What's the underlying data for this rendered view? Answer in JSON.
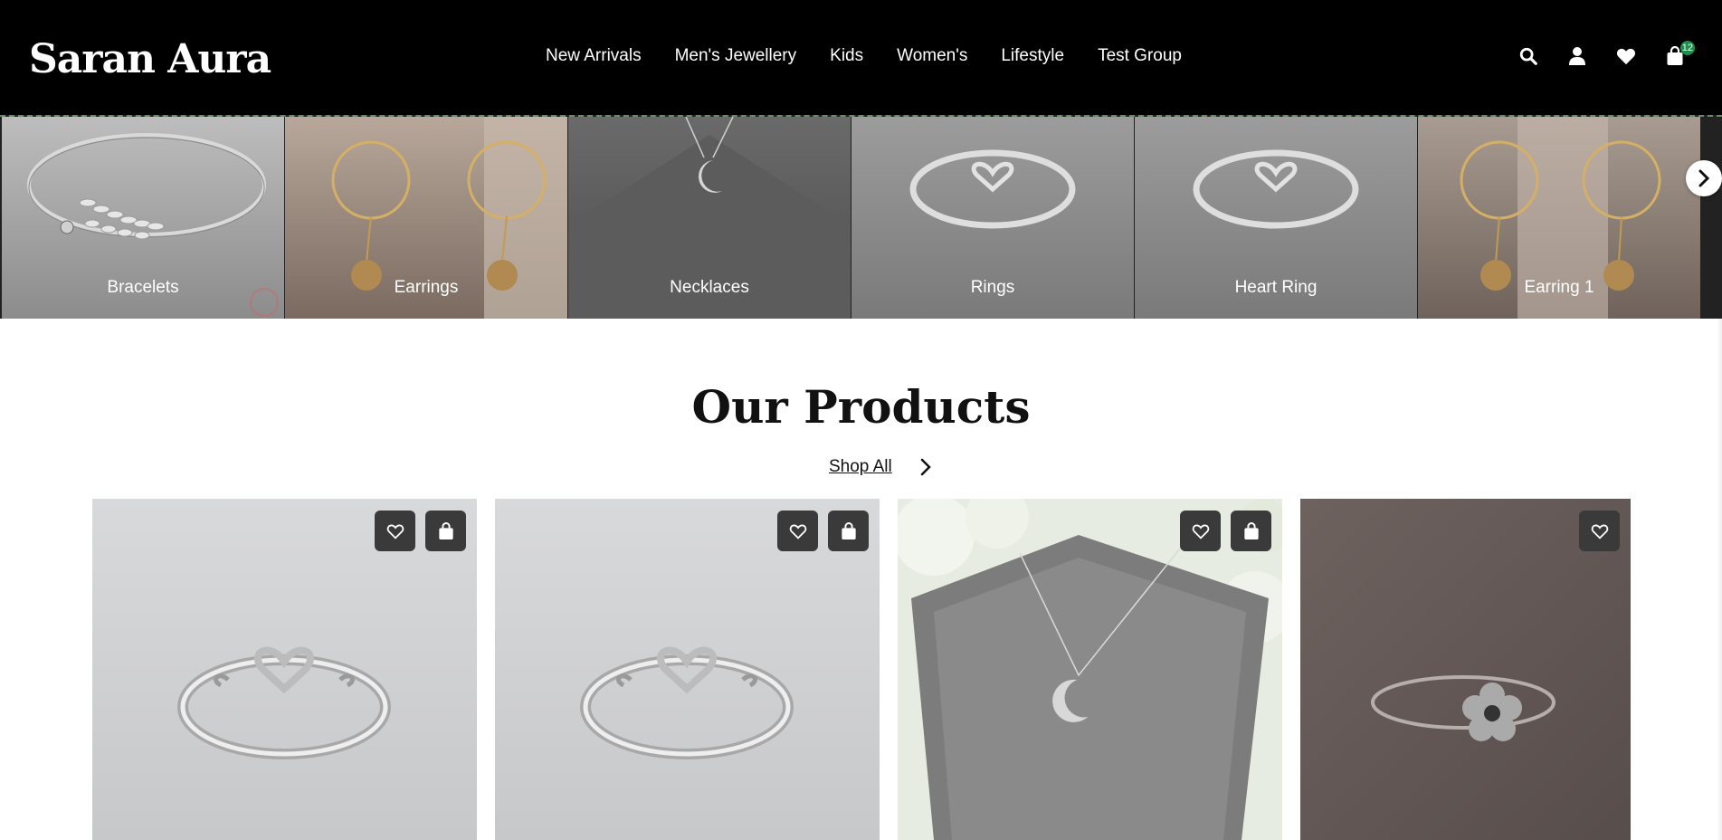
{
  "header": {
    "logo": "Saran Aura",
    "nav": [
      "New Arrivals",
      "Men's Jewellery",
      "Kids",
      "Women's",
      "Lifestyle",
      "Test Group"
    ],
    "icons": [
      "search-icon",
      "user-icon",
      "heart-icon",
      "bag-icon"
    ],
    "cart_count": "12"
  },
  "categories": [
    {
      "label": "Bracelets"
    },
    {
      "label": "Earrings"
    },
    {
      "label": "Necklaces"
    },
    {
      "label": "Rings"
    },
    {
      "label": "Heart Ring"
    },
    {
      "label": "Earring 1"
    }
  ],
  "products_section": {
    "title": "Our Products",
    "shop_all": "Shop All"
  },
  "products": [
    {
      "image": "heart-ring",
      "has_cart": true
    },
    {
      "image": "heart-ring",
      "has_cart": true
    },
    {
      "image": "moon-necklace",
      "has_cart": true
    },
    {
      "image": "flower-ring",
      "has_cart": false
    }
  ],
  "colors": {
    "header_bg": "#000000",
    "badge": "#1d8f4a",
    "action_btn": "#3a3a3a"
  }
}
